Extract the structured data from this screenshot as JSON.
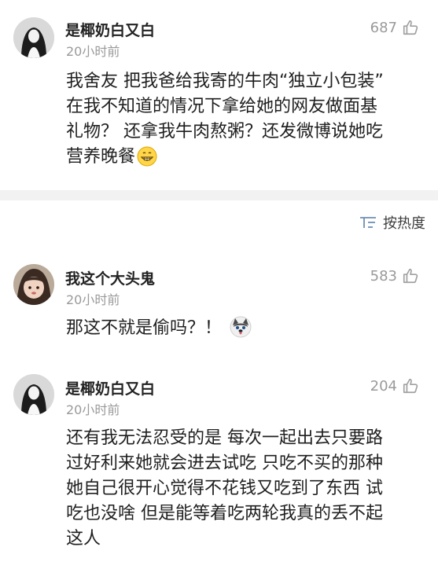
{
  "top_comment": {
    "username": "是椰奶白又白",
    "time": "20小时前",
    "likes": "687",
    "lines": [
      "我舍友 把我爸给我寄的牛肉“独立小包装”",
      "在我不知道的情况下拿给她的网友做面基",
      "礼物？ 还拿我牛肉熬粥？还发微博说她吃",
      "营养晚餐"
    ]
  },
  "sort": {
    "icon": "sort-icon",
    "label": "按热度"
  },
  "replies": [
    {
      "username": "我这个大头鬼",
      "time": "20小时前",
      "likes": "583",
      "lines": [
        "那这不就是偷吗？！"
      ]
    },
    {
      "username": "是椰奶白又白",
      "time": "20小时前",
      "likes": "204",
      "lines": [
        "还有我无法忍受的是 每次一起出去只要路",
        "过好利来她就会进去试吃 只吃不买的那种",
        "她自己很开心觉得不花钱又吃到了东西 试",
        "吃也没啥 但是能等着吃两轮我真的丢不起",
        "这人"
      ]
    }
  ],
  "icons": {
    "like": "thumbs-up-icon",
    "grin_emoji": "grinning-face-emoji",
    "husky_emoji": "husky-dog-emoji"
  }
}
